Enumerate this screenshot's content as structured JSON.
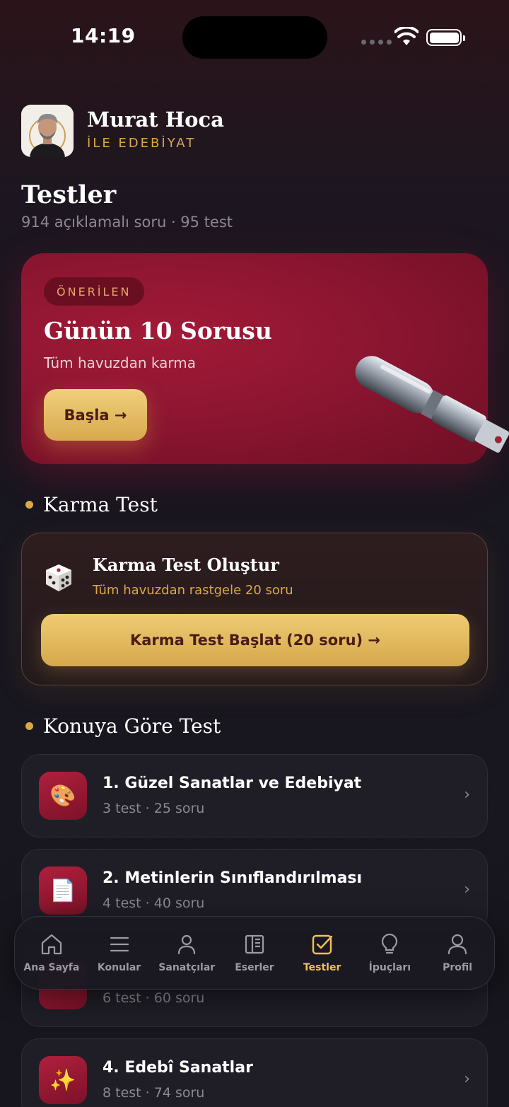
{
  "status": {
    "time": "14:19"
  },
  "brand": {
    "name": "Murat Hoca",
    "subtitle": "İLE EDEBİYAT"
  },
  "page": {
    "title": "Testler",
    "subtitle": "914 açıklamalı soru · 95 test"
  },
  "hero": {
    "badge": "ÖNERİLEN",
    "title": "Günün 10 Sorusu",
    "subtitle": "Tüm havuzdan karma",
    "button": "Başla →"
  },
  "sections": {
    "mix": "Karma Test",
    "by_topic": "Konuya Göre Test"
  },
  "mix_card": {
    "title": "Karma Test Oluştur",
    "subtitle": "Tüm havuzdan rastgele 20 soru",
    "button": "Karma Test Başlat (20 soru) →"
  },
  "topics": [
    {
      "title": "1. Güzel Sanatlar ve Edebiyat",
      "meta": "3 test · 25 soru",
      "icon": "palette-icon",
      "glyph": "🎨"
    },
    {
      "title": "2. Metinlerin Sınıflandırılması",
      "meta": "4 test · 40 soru",
      "icon": "document-icon",
      "glyph": "📄"
    },
    {
      "title": "",
      "meta": "6 test · 60 soru",
      "icon": "topic-icon",
      "glyph": ""
    },
    {
      "title": "4. Edebî Sanatlar",
      "meta": "8 test · 74 soru",
      "icon": "sparkles-icon",
      "glyph": "✨"
    }
  ],
  "chevron": "›",
  "tabs": [
    {
      "label": "Ana Sayfa",
      "icon": "home-icon",
      "active": false
    },
    {
      "label": "Konular",
      "icon": "menu-icon",
      "active": false
    },
    {
      "label": "Sanatçılar",
      "icon": "person-icon",
      "active": false
    },
    {
      "label": "Eserler",
      "icon": "book-icon",
      "active": false
    },
    {
      "label": "Testler",
      "icon": "checkbox-icon",
      "active": true
    },
    {
      "label": "İpuçları",
      "icon": "lightbulb-icon",
      "active": false
    },
    {
      "label": "Profil",
      "icon": "profile-icon",
      "active": false
    }
  ],
  "colors": {
    "accent": "#d9a84a",
    "hero": "#8a1530",
    "tab_active": "#f0c257"
  }
}
